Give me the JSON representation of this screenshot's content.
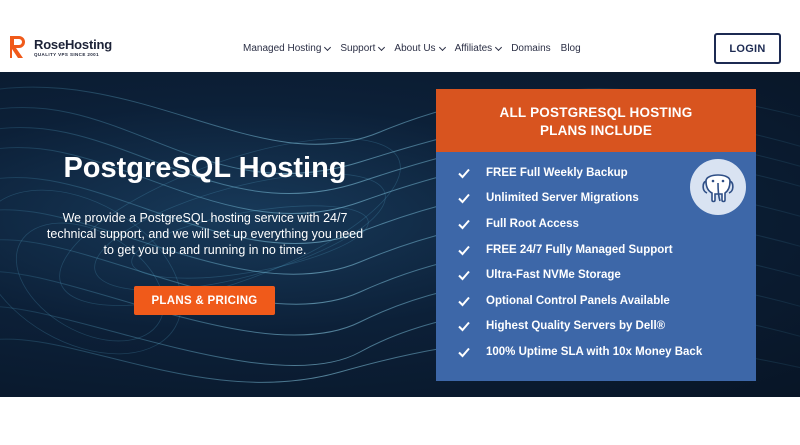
{
  "header": {
    "logo_text": "RoseHosting",
    "logo_tagline": "QUALITY VPS SINCE 2001",
    "nav": [
      {
        "label": "Managed Hosting",
        "dropdown": true
      },
      {
        "label": "Support",
        "dropdown": true
      },
      {
        "label": "About Us",
        "dropdown": true
      },
      {
        "label": "Affiliates",
        "dropdown": true
      },
      {
        "label": "Domains",
        "dropdown": false
      },
      {
        "label": "Blog",
        "dropdown": false
      }
    ],
    "login_label": "LOGIN"
  },
  "hero": {
    "title": "PostgreSQL Hosting",
    "description": "We provide a PostgreSQL hosting service with 24/7 technical support, and we will set up everything you need to get you up and running in no time.",
    "cta_label": "PLANS & PRICING"
  },
  "panel": {
    "title_line1": "ALL POSTGRESQL HOSTING",
    "title_line2": "PLANS INCLUDE",
    "icon": "postgresql-elephant-icon",
    "features": [
      "FREE Full Weekly Backup",
      "Unlimited Server Migrations",
      "Full Root Access",
      "FREE 24/7 Fully Managed Support",
      "Ultra-Fast NVMe Storage",
      "Optional Control Panels Available",
      "Highest Quality Servers by Dell®",
      "100% Uptime SLA with 10x Money Back"
    ]
  },
  "colors": {
    "brand_orange": "#f05a1a",
    "panel_header": "#d8541f",
    "panel_body": "#3d67a8",
    "navy": "#1c2a52",
    "hero_bg": "#0c2038"
  }
}
